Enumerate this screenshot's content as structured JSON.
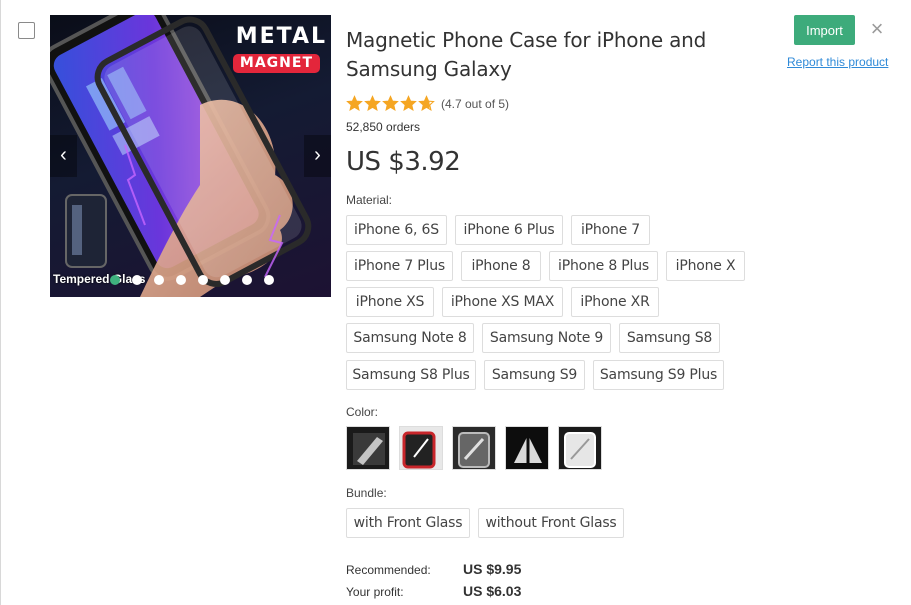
{
  "product": {
    "title": "Magnetic Phone Case for iPhone and Samsung Galaxy",
    "rating_text": "(4.7 out of 5)",
    "rating_value": 4.7,
    "orders": "52,850 orders",
    "price": "US $3.92"
  },
  "gallery": {
    "brand_top": "METAL",
    "brand_badge": "MAGNET",
    "caption": "Tempered Glass",
    "prev_icon": "chevron-left-icon",
    "next_icon": "chevron-right-icon",
    "slide_count": 8,
    "active_slide": 1
  },
  "material": {
    "label": "Material:",
    "options": [
      "iPhone 6, 6S",
      "iPhone 6 Plus",
      "iPhone 7",
      "iPhone 7 Plus",
      "iPhone 8",
      "iPhone 8 Plus",
      "iPhone X",
      "iPhone XS",
      "iPhone XS MAX",
      "iPhone XR",
      "Samsung Note 8",
      "Samsung Note 9",
      "Samsung S8",
      "Samsung S8 Plus",
      "Samsung S9",
      "Samsung S9 Plus"
    ]
  },
  "color": {
    "label": "Color:",
    "swatch_icons": [
      "phone-case-black-icon",
      "phone-case-red-icon",
      "phone-case-silver-icon",
      "phone-case-black-white-icon",
      "phone-case-white-icon"
    ],
    "accents": [
      "#222222",
      "#c8262b",
      "#9a9a9a",
      "#111111",
      "#e6e6e6"
    ]
  },
  "bundle": {
    "label": "Bundle:",
    "options": [
      "with Front Glass",
      "without Front Glass"
    ]
  },
  "actions": {
    "import_label": "Import",
    "close_icon": "close-icon",
    "report_label": "Report this product"
  },
  "summary": {
    "recommended_label": "Recommended:",
    "recommended_value": "US $9.95",
    "profit_label": "Your profit:",
    "profit_value": "US $6.03"
  },
  "colors": {
    "accent": "#3dab7b",
    "link": "#2f8ad8",
    "star": "#f5a623"
  }
}
